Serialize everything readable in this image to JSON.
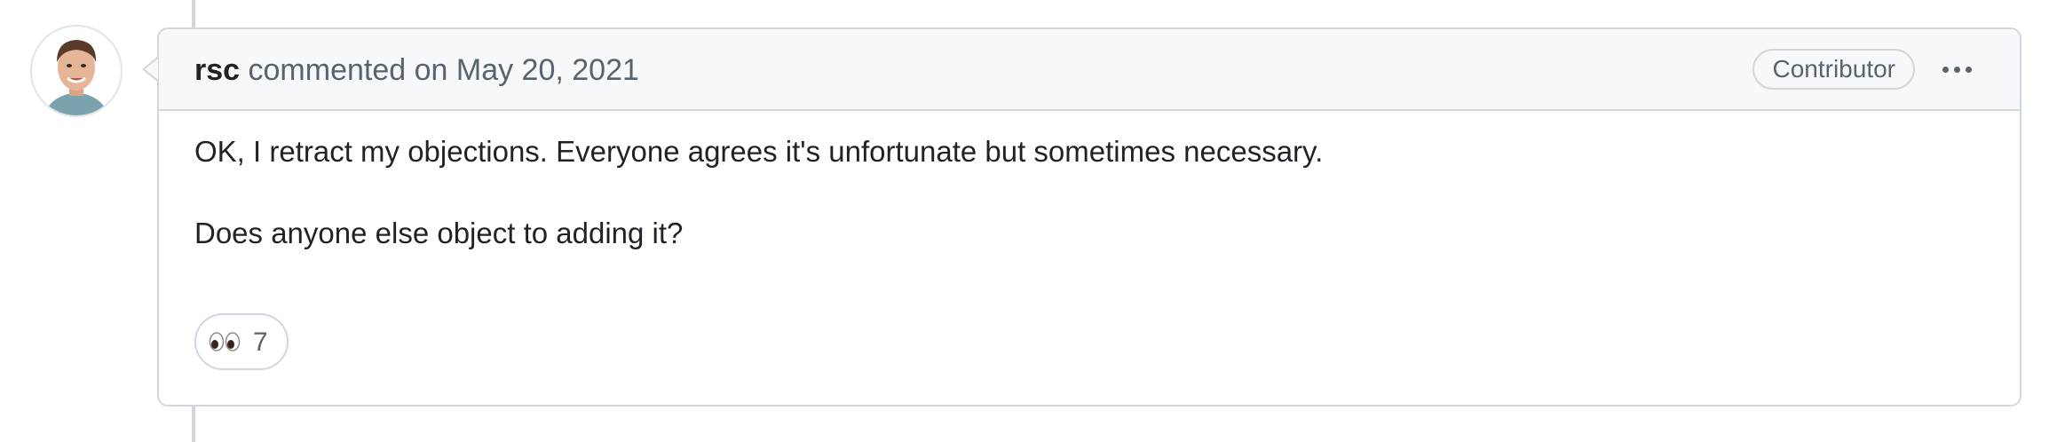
{
  "comment": {
    "author": "rsc",
    "action_label": "commented on",
    "date": "May 20, 2021",
    "role_badge": "Contributor",
    "more_actions_icon": "kebab-horizontal-icon",
    "body": [
      "OK, I retract my objections. Everyone agrees it's unfortunate but sometimes necessary.",
      "Does anyone else object to adding it?"
    ],
    "reactions": [
      {
        "emoji": "eyes-emoji",
        "count": "7"
      }
    ]
  },
  "colors": {
    "border": "#d0d7de",
    "header_bg": "#f6f8fa",
    "muted_text": "#59636e",
    "text": "#1f2328"
  }
}
